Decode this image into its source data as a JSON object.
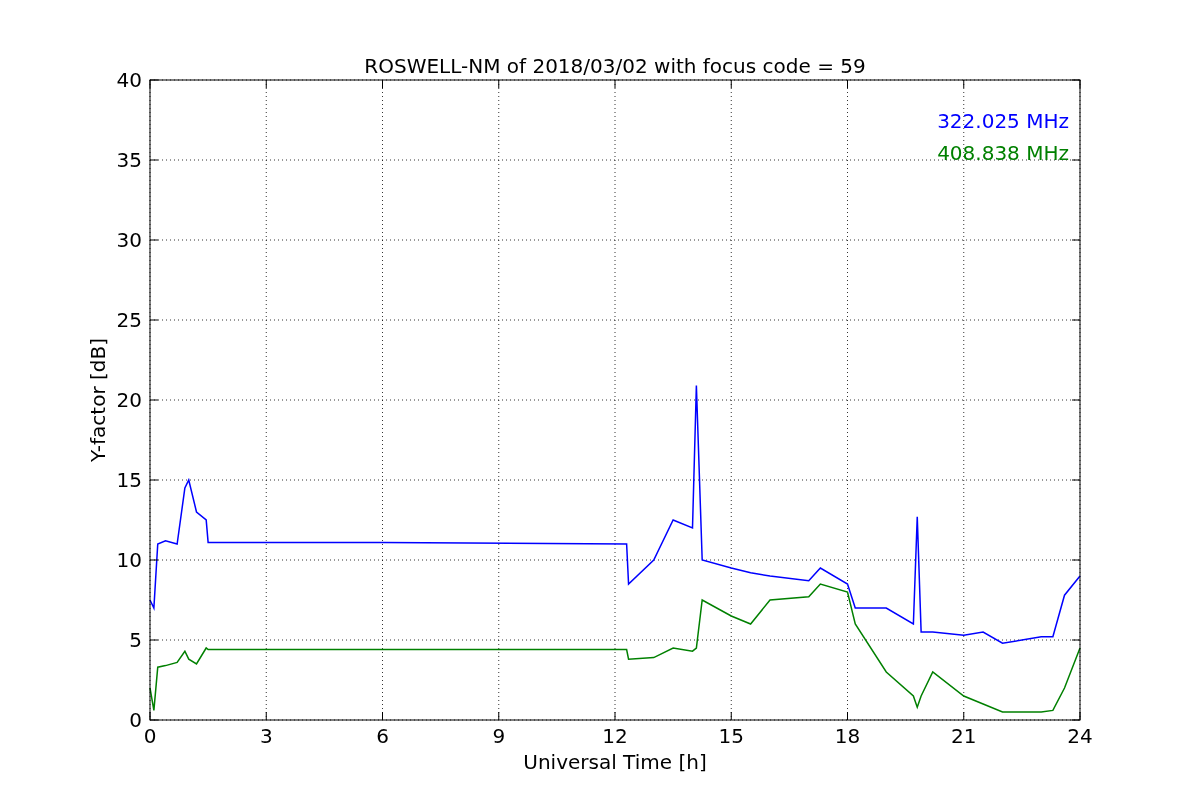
{
  "chart_data": {
    "type": "line",
    "title": "ROSWELL-NM of 2018/03/02 with focus code = 59",
    "xlabel": "Universal Time [h]",
    "ylabel": "Y-factor [dB]",
    "x": [
      0,
      0.1,
      0.2,
      0.4,
      0.7,
      0.9,
      1.0,
      1.2,
      1.45,
      1.5,
      6,
      12.3,
      12.35,
      13,
      13.5,
      14,
      14.1,
      14.25,
      15,
      15.5,
      16,
      17,
      17.3,
      18,
      18.2,
      19,
      19.7,
      19.8,
      19.9,
      20.2,
      21,
      21.5,
      22,
      23,
      23.3,
      23.6,
      24
    ],
    "series": [
      {
        "name": "322.025 MHz",
        "color": "#0000ff",
        "values": [
          7.5,
          7,
          11,
          11.2,
          11,
          14.5,
          15,
          13,
          12.5,
          11.1,
          11.1,
          11,
          8.5,
          10,
          12.5,
          12,
          20.9,
          10,
          9.5,
          9.2,
          9,
          8.7,
          9.5,
          8.5,
          7,
          7,
          6,
          12.7,
          5.5,
          5.5,
          5.3,
          5.5,
          4.8,
          5.2,
          5.2,
          7.8,
          9
        ]
      },
      {
        "name": "408.838 MHz",
        "color": "#008000",
        "values": [
          2,
          0.6,
          3.3,
          3.4,
          3.6,
          4.3,
          3.8,
          3.5,
          4.5,
          4.4,
          4.4,
          4.4,
          3.8,
          3.9,
          4.5,
          4.3,
          4.5,
          7.5,
          6.5,
          6,
          7.5,
          7.7,
          8.5,
          8,
          6,
          3,
          1.5,
          0.8,
          1.5,
          3,
          1.5,
          1,
          0.5,
          0.5,
          0.6,
          2,
          4.5
        ]
      }
    ],
    "grid": true,
    "xlim": [
      0,
      24
    ],
    "ylim": [
      0,
      40
    ],
    "xticks": [
      0,
      3,
      6,
      9,
      12,
      15,
      18,
      21,
      24
    ],
    "yticks": [
      0,
      5,
      10,
      15,
      20,
      25,
      30,
      35,
      40
    ]
  }
}
